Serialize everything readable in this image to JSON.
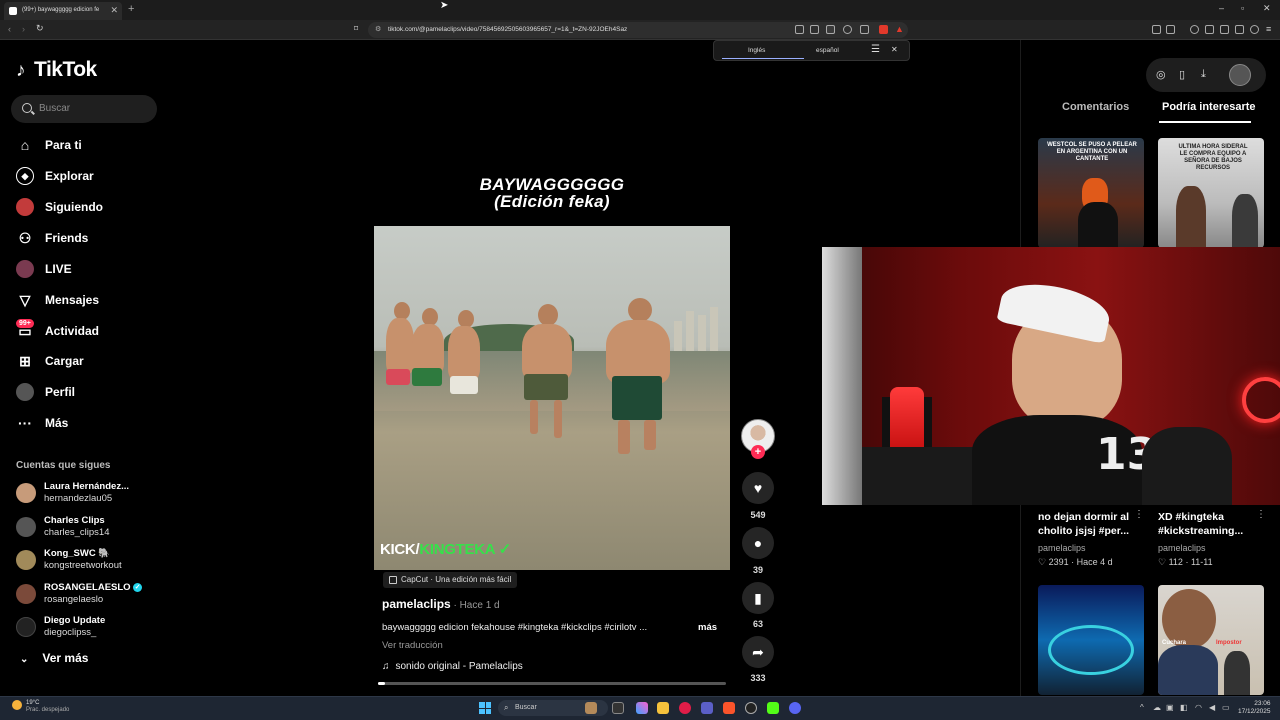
{
  "browser": {
    "tab_title": "(99+) baywaggggg edicion fe",
    "new_tab": "+",
    "url": "tiktok.com/@pamelaclips/video/75845692505603965657_r=1&_t=ZN-92JOEh4Saz",
    "window_controls": [
      "–",
      "▫",
      "✕"
    ]
  },
  "translate_popup": {
    "lang_from": "Inglés",
    "lang_to": "español"
  },
  "sidebar": {
    "logo": "TikTok",
    "search_placeholder": "Buscar",
    "nav": [
      {
        "label": "Para ti",
        "icon": "home-icon"
      },
      {
        "label": "Explorar",
        "icon": "compass-icon"
      },
      {
        "label": "Siguiendo",
        "icon": "following-avatar-icon"
      },
      {
        "label": "Friends",
        "icon": "friends-icon"
      },
      {
        "label": "LIVE",
        "icon": "live-avatar-icon"
      },
      {
        "label": "Mensajes",
        "icon": "messages-icon"
      },
      {
        "label": "Actividad",
        "icon": "activity-icon"
      },
      {
        "label": "Cargar",
        "icon": "upload-icon"
      },
      {
        "label": "Perfil",
        "icon": "profile-icon"
      },
      {
        "label": "Más",
        "icon": "more-icon"
      }
    ],
    "activity_badge": "99+",
    "following_title": "Cuentas que sigues",
    "following": [
      {
        "name": "Laura Hernández...",
        "username": "hernandezlau05"
      },
      {
        "name": "Charles Clips",
        "username": "charles_clips14"
      },
      {
        "name": "Kong_SWC 🐘",
        "username": "kongstreetworkout"
      },
      {
        "name": "ROSANGELAESLO",
        "username": "rosangelaeslo"
      },
      {
        "name": "Diego Update",
        "username": "diegoclipss_"
      }
    ],
    "see_more": "Ver más"
  },
  "video": {
    "overlay_title_line1": "BAYWAGGGGGG",
    "overlay_title_line2": "(Edición feka)",
    "watermark_kick": "KICK/",
    "watermark_name": "KINGTEKA",
    "capcut_label": "CapCut · Una edición más fácil",
    "author": "pamelaclips",
    "time": " · Hace 1 d",
    "description": "baywaggggg edicion fekahouse #kingteka #kickclips #cirilotv ...",
    "more": "más",
    "translate": "Ver traducción",
    "sound": "sonido original - Pamelaclips",
    "progress_fraction": 0.02
  },
  "actions": {
    "likes": "549",
    "comments": "39",
    "saves": "63",
    "shares": "333"
  },
  "right_panel": {
    "tab_comments": "Comentarios",
    "tab_related": "Podría interesarte",
    "thumb1_caption": "WESTCOL SE PUSO A PELEAR EN ARGENTINA CON UN CANTANTE",
    "thumb2_caption": "ULTIMA HORA SIDERAL LE COMPRA EQUIPO A SEÑORA DE BAJOS RECURSOS",
    "items": [
      {
        "title": "no dejan dormir al cholito jsjsj #per...",
        "author": "pamelaclips",
        "likes": "2391",
        "time": "Hace 4 d"
      },
      {
        "title": "XD #kingteka #kickstreaming...",
        "author": "pamelaclips",
        "likes": "112",
        "time": "11-11"
      }
    ],
    "thumb4_caption_left": "Cuchara",
    "thumb4_caption_right": "Impostor"
  },
  "taskbar": {
    "weather_temp": "19°C",
    "weather_desc": "Prac. despejado",
    "search": "Buscar",
    "time": "23:06",
    "date": "17/12/2025"
  }
}
